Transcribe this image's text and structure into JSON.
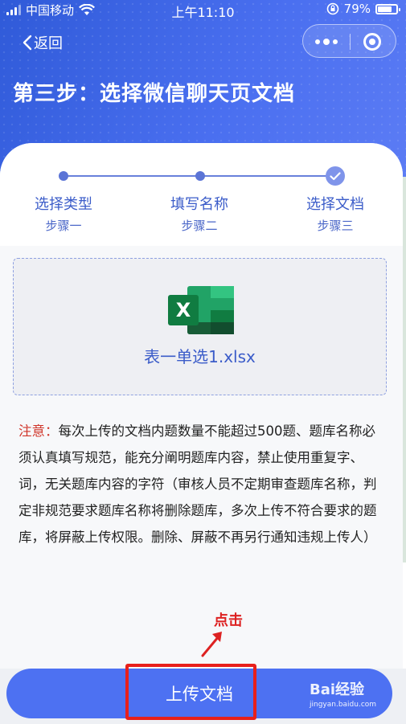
{
  "status_bar": {
    "carrier": "中国移动",
    "time": "上午11:10",
    "battery": "79%",
    "battery_level": 0.79
  },
  "nav": {
    "back_label": "返回"
  },
  "header": {
    "title": "第三步：选择微信聊天页文档"
  },
  "steps": [
    {
      "label": "选择类型",
      "sub": "步骤一"
    },
    {
      "label": "填写名称",
      "sub": "步骤二"
    },
    {
      "label": "选择文档",
      "sub": "步骤三"
    }
  ],
  "upload": {
    "file_icon_letter": "X",
    "file_name": "表一单选1.xlsx"
  },
  "notice": {
    "label": "注意：",
    "text": "每次上传的文档内题数量不能超过500题、题库名称必须认真填写规范，能充分阐明题库内容，禁止使用重复字、词，无关题库内容的字符（审核人员不定期审查题库名称，判定非规范要求题库名称将删除题库，多次上传不符合要求的题库，将屏蔽上传权限。删除、屏蔽不再另行通知违规上传人）"
  },
  "annotation": {
    "text": "点击"
  },
  "footer": {
    "upload_button": "上传文档"
  },
  "watermark": {
    "brand": "Bai经验",
    "url": "jingyan.baidu.com"
  },
  "colors": {
    "primary": "#4d71f2",
    "header_start": "#2f5ad8",
    "step_active": "#5b74d6",
    "notice_label": "#d0352a",
    "highlight": "#e8201b"
  }
}
